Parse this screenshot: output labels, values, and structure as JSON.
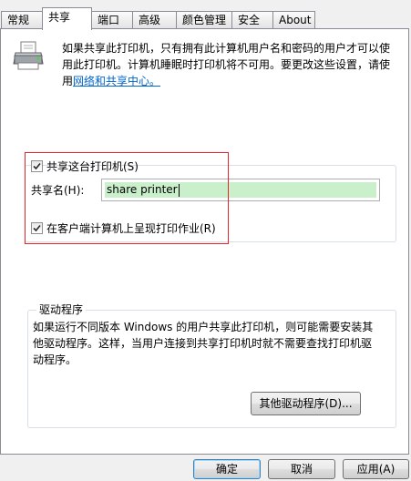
{
  "tabs": [
    {
      "label": "常规",
      "active": false
    },
    {
      "label": "共享",
      "active": true
    },
    {
      "label": "端口",
      "active": false
    },
    {
      "label": "高级",
      "active": false
    },
    {
      "label": "颜色管理",
      "active": false
    },
    {
      "label": "安全",
      "active": false
    },
    {
      "label": "About",
      "active": false
    }
  ],
  "icons": {
    "printer": "printer-icon",
    "checkmark": "checkmark-icon"
  },
  "info": {
    "text": "如果共享此打印机，只有拥有此计算机用户名和密码的用户才可以使用此打印机。计算机睡眠时打印机将不可用。要更改这些设置，请使用",
    "link": "网络和共享中心。"
  },
  "sharing": {
    "share_checkbox_label": "共享这台打印机(S)",
    "share_checked": true,
    "share_name_label": "共享名(H):",
    "share_name_value": "share printer",
    "render_checkbox_label": "在客户端计算机上呈现打印作业(R)",
    "render_checked": true
  },
  "drivers": {
    "title": "驱动程序",
    "description": "如果运行不同版本 Windows 的用户共享此打印机，则可能需要安装其他驱动程序。这样，当用户连接到共享打印机时就不需要查找打印机驱动程序。",
    "button": "其他驱动程序(D)..."
  },
  "footer": {
    "ok": "确定",
    "cancel": "取消",
    "apply": "应用(A)"
  },
  "colors": {
    "highlight_box": "#e8242a",
    "name_highlight": "#c9efcb",
    "link": "#0066cc"
  }
}
